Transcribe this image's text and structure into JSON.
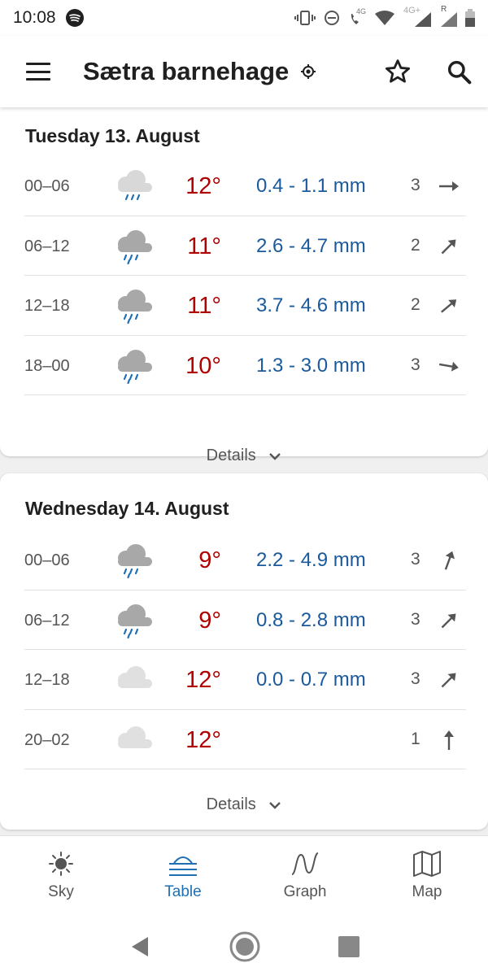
{
  "status_bar": {
    "time": "10:08",
    "network_label": "4G",
    "network_label_2": "4G+",
    "roaming_label": "R"
  },
  "app_bar": {
    "title": "Sætra barnehage",
    "icons": [
      "menu-icon",
      "location-icon",
      "star-icon",
      "search-icon"
    ]
  },
  "days": [
    {
      "date": "Tuesday 13. August",
      "rows": [
        {
          "time": "00–06",
          "icon": "light-rain-cloud",
          "temp": "12°",
          "precip": "0.4 - 1.1 mm",
          "wind": "3",
          "wind_dir_deg": 90
        },
        {
          "time": "06–12",
          "icon": "rain-cloud",
          "temp": "11°",
          "precip": "2.6 - 4.7 mm",
          "wind": "2",
          "wind_dir_deg": 45
        },
        {
          "time": "12–18",
          "icon": "rain-cloud",
          "temp": "11°",
          "precip": "3.7 - 4.6 mm",
          "wind": "2",
          "wind_dir_deg": 50
        },
        {
          "time": "18–00",
          "icon": "rain-cloud",
          "temp": "10°",
          "precip": "1.3 - 3.0 mm",
          "wind": "3",
          "wind_dir_deg": 100
        }
      ],
      "details_label": "Details"
    },
    {
      "date": "Wednesday 14. August",
      "rows": [
        {
          "time": "00–06",
          "icon": "rain-cloud",
          "temp": "9°",
          "precip": "2.2 - 4.9 mm",
          "wind": "3",
          "wind_dir_deg": 20
        },
        {
          "time": "06–12",
          "icon": "rain-cloud",
          "temp": "9°",
          "precip": "0.8 - 2.8 mm",
          "wind": "3",
          "wind_dir_deg": 45
        },
        {
          "time": "12–18",
          "icon": "cloud",
          "temp": "12°",
          "precip": "0.0 - 0.7 mm",
          "wind": "3",
          "wind_dir_deg": 45
        },
        {
          "time": "20–02",
          "icon": "cloud",
          "temp": "12°",
          "precip": "",
          "wind": "1",
          "wind_dir_deg": 0
        }
      ],
      "details_label": "Details"
    }
  ],
  "bottom_nav": {
    "items": [
      {
        "label": "Sky",
        "icon": "sun-icon",
        "active": false
      },
      {
        "label": "Table",
        "icon": "table-icon",
        "active": true
      },
      {
        "label": "Graph",
        "icon": "graph-icon",
        "active": false
      },
      {
        "label": "Map",
        "icon": "map-icon",
        "active": false
      }
    ]
  },
  "colors": {
    "temperature": "#b00000",
    "precipitation": "#1a5a9c",
    "active_nav": "#1f6fb5",
    "text": "#202020",
    "muted": "#555555"
  }
}
